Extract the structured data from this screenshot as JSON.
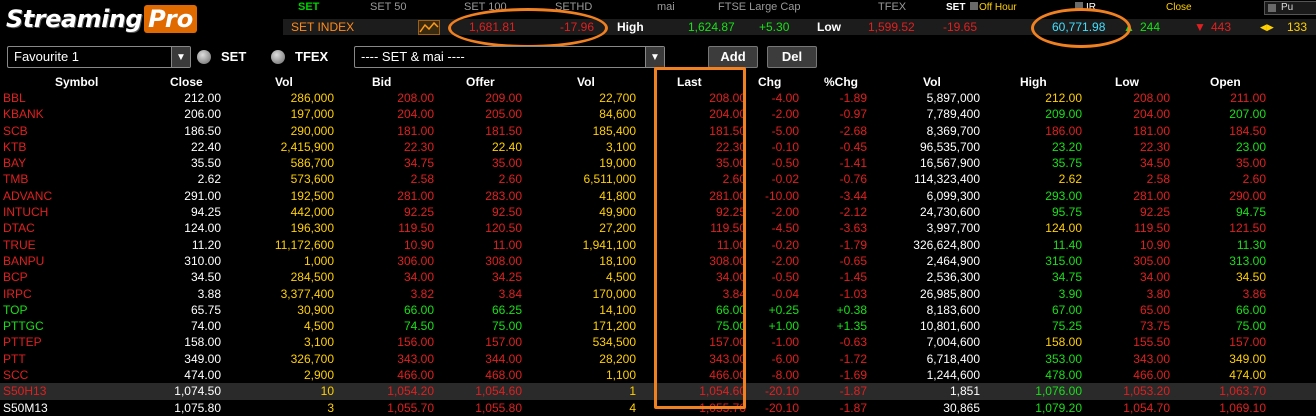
{
  "app": {
    "brand_main": "Streaming",
    "brand_sub": "Pro"
  },
  "market_tabs": [
    "SET",
    "SET 50",
    "SET 100",
    "SETHD",
    "mai",
    "FTSE Large Cap",
    "TFEX"
  ],
  "market_status": {
    "market": "SET",
    "state": "Off Hour",
    "ir": "IR",
    "session": "Close",
    "push": "Pu"
  },
  "index_bar": {
    "name": "SET INDEX",
    "value": "1,681.81",
    "change": "-17.96",
    "high_label": "High",
    "high_value": "1,624.87",
    "high_change": "+5.30",
    "low_label": "Low",
    "low_value": "1,599.52",
    "low_change": "-19.65",
    "volume": "60,771.98",
    "up_count": "244",
    "down_count": "443",
    "unchanged_count": "133"
  },
  "toolbar": {
    "favourite": "Favourite 1",
    "radio_set": "SET",
    "radio_tfex": "TFEX",
    "market_select": "---- SET & mai ----",
    "add_label": "Add",
    "del_label": "Del"
  },
  "table": {
    "headers": [
      "Symbol",
      "Close",
      "Vol",
      "Bid",
      "Offer",
      "Vol",
      "Last",
      "Chg",
      "%Chg",
      "Vol",
      "High",
      "Low",
      "Open"
    ],
    "rows": [
      {
        "symbol": "BBL",
        "close": "212.00",
        "bidvol": "286,000",
        "bid": "208.00",
        "offer": "209.00",
        "offervol": "22,700",
        "last": "208.00",
        "chg": "-4.00",
        "pchg": "-1.89",
        "vol": "5,897,000",
        "high": "212.00",
        "low": "208.00",
        "open": "211.00",
        "c": {
          "sym": "red",
          "bid": "red",
          "offer": "red",
          "last": "red",
          "chg": "red",
          "pchg": "red",
          "high": "yel",
          "low": "red",
          "open": "red"
        }
      },
      {
        "symbol": "KBANK",
        "close": "206.00",
        "bidvol": "197,000",
        "bid": "204.00",
        "offer": "205.00",
        "offervol": "84,600",
        "last": "204.00",
        "chg": "-2.00",
        "pchg": "-0.97",
        "vol": "7,789,400",
        "high": "209.00",
        "low": "204.00",
        "open": "207.00",
        "c": {
          "sym": "red",
          "bid": "red",
          "offer": "red",
          "last": "red",
          "chg": "red",
          "pchg": "red",
          "high": "grn",
          "low": "red",
          "open": "grn"
        }
      },
      {
        "symbol": "SCB",
        "close": "186.50",
        "bidvol": "290,000",
        "bid": "181.00",
        "offer": "181.50",
        "offervol": "185,400",
        "last": "181.50",
        "chg": "-5.00",
        "pchg": "-2.68",
        "vol": "8,369,700",
        "high": "186.00",
        "low": "181.00",
        "open": "184.50",
        "c": {
          "sym": "red",
          "bid": "red",
          "offer": "red",
          "last": "red",
          "chg": "red",
          "pchg": "red",
          "high": "red",
          "low": "red",
          "open": "red"
        }
      },
      {
        "symbol": "KTB",
        "close": "22.40",
        "bidvol": "2,415,900",
        "bid": "22.30",
        "offer": "22.40",
        "offervol": "3,100",
        "last": "22.30",
        "chg": "-0.10",
        "pchg": "-0.45",
        "vol": "96,535,700",
        "high": "23.20",
        "low": "22.30",
        "open": "23.00",
        "c": {
          "sym": "red",
          "bid": "red",
          "offer": "yel",
          "last": "red",
          "chg": "red",
          "pchg": "red",
          "high": "grn",
          "low": "red",
          "open": "grn"
        }
      },
      {
        "symbol": "BAY",
        "close": "35.50",
        "bidvol": "586,700",
        "bid": "34.75",
        "offer": "35.00",
        "offervol": "19,000",
        "last": "35.00",
        "chg": "-0.50",
        "pchg": "-1.41",
        "vol": "16,567,900",
        "high": "35.75",
        "low": "34.50",
        "open": "35.00",
        "c": {
          "sym": "red",
          "bid": "red",
          "offer": "red",
          "last": "red",
          "chg": "red",
          "pchg": "red",
          "high": "grn",
          "low": "red",
          "open": "red"
        }
      },
      {
        "symbol": "TMB",
        "close": "2.62",
        "bidvol": "573,600",
        "bid": "2.58",
        "offer": "2.60",
        "offervol": "6,511,000",
        "last": "2.60",
        "chg": "-0.02",
        "pchg": "-0.76",
        "vol": "114,323,400",
        "high": "2.62",
        "low": "2.58",
        "open": "2.60",
        "c": {
          "sym": "red",
          "bid": "red",
          "offer": "red",
          "last": "red",
          "chg": "red",
          "pchg": "red",
          "high": "yel",
          "low": "red",
          "open": "red"
        }
      },
      {
        "symbol": "ADVANC",
        "close": "291.00",
        "bidvol": "192,500",
        "bid": "281.00",
        "offer": "283.00",
        "offervol": "41,800",
        "last": "281.00",
        "chg": "-10.00",
        "pchg": "-3.44",
        "vol": "6,099,300",
        "high": "293.00",
        "low": "281.00",
        "open": "290.00",
        "c": {
          "sym": "red",
          "bid": "red",
          "offer": "red",
          "last": "red",
          "chg": "red",
          "pchg": "red",
          "high": "grn",
          "low": "red",
          "open": "red"
        }
      },
      {
        "symbol": "INTUCH",
        "close": "94.25",
        "bidvol": "442,000",
        "bid": "92.25",
        "offer": "92.50",
        "offervol": "49,900",
        "last": "92.25",
        "chg": "-2.00",
        "pchg": "-2.12",
        "vol": "24,730,600",
        "high": "95.75",
        "low": "92.25",
        "open": "94.75",
        "c": {
          "sym": "red",
          "bid": "red",
          "offer": "red",
          "last": "red",
          "chg": "red",
          "pchg": "red",
          "high": "grn",
          "low": "red",
          "open": "grn"
        }
      },
      {
        "symbol": "DTAC",
        "close": "124.00",
        "bidvol": "196,300",
        "bid": "119.50",
        "offer": "120.50",
        "offervol": "27,200",
        "last": "119.50",
        "chg": "-4.50",
        "pchg": "-3.63",
        "vol": "3,997,700",
        "high": "124.00",
        "low": "119.50",
        "open": "121.50",
        "c": {
          "sym": "red",
          "bid": "red",
          "offer": "red",
          "last": "red",
          "chg": "red",
          "pchg": "red",
          "high": "yel",
          "low": "red",
          "open": "red"
        }
      },
      {
        "symbol": "TRUE",
        "close": "11.20",
        "bidvol": "11,172,600",
        "bid": "10.90",
        "offer": "11.00",
        "offervol": "1,941,100",
        "last": "11.00",
        "chg": "-0.20",
        "pchg": "-1.79",
        "vol": "326,624,800",
        "high": "11.40",
        "low": "10.90",
        "open": "11.30",
        "c": {
          "sym": "red",
          "bid": "red",
          "offer": "red",
          "last": "red",
          "chg": "red",
          "pchg": "red",
          "high": "grn",
          "low": "red",
          "open": "grn"
        }
      },
      {
        "symbol": "BANPU",
        "close": "310.00",
        "bidvol": "1,000",
        "bid": "306.00",
        "offer": "308.00",
        "offervol": "18,100",
        "last": "308.00",
        "chg": "-2.00",
        "pchg": "-0.65",
        "vol": "2,464,900",
        "high": "315.00",
        "low": "305.00",
        "open": "313.00",
        "c": {
          "sym": "red",
          "bid": "red",
          "offer": "red",
          "last": "red",
          "chg": "red",
          "pchg": "red",
          "high": "grn",
          "low": "red",
          "open": "grn"
        }
      },
      {
        "symbol": "BCP",
        "close": "34.50",
        "bidvol": "284,500",
        "bid": "34.00",
        "offer": "34.25",
        "offervol": "4,500",
        "last": "34.00",
        "chg": "-0.50",
        "pchg": "-1.45",
        "vol": "2,536,300",
        "high": "34.75",
        "low": "34.00",
        "open": "34.50",
        "c": {
          "sym": "red",
          "bid": "red",
          "offer": "red",
          "last": "red",
          "chg": "red",
          "pchg": "red",
          "high": "grn",
          "low": "red",
          "open": "yel"
        }
      },
      {
        "symbol": "IRPC",
        "close": "3.88",
        "bidvol": "3,377,400",
        "bid": "3.82",
        "offer": "3.84",
        "offervol": "170,000",
        "last": "3.84",
        "chg": "-0.04",
        "pchg": "-1.03",
        "vol": "26,985,800",
        "high": "3.90",
        "low": "3.80",
        "open": "3.86",
        "c": {
          "sym": "red",
          "bid": "red",
          "offer": "red",
          "last": "red",
          "chg": "red",
          "pchg": "red",
          "high": "grn",
          "low": "red",
          "open": "red"
        }
      },
      {
        "symbol": "TOP",
        "close": "65.75",
        "bidvol": "30,900",
        "bid": "66.00",
        "offer": "66.25",
        "offervol": "14,100",
        "last": "66.00",
        "chg": "+0.25",
        "pchg": "+0.38",
        "vol": "8,183,600",
        "high": "67.00",
        "low": "65.00",
        "open": "66.00",
        "c": {
          "sym": "grn",
          "bid": "grn",
          "offer": "grn",
          "last": "grn",
          "chg": "grn",
          "pchg": "grn",
          "high": "grn",
          "low": "red",
          "open": "grn"
        }
      },
      {
        "symbol": "PTTGC",
        "close": "74.00",
        "bidvol": "4,500",
        "bid": "74.50",
        "offer": "75.00",
        "offervol": "171,200",
        "last": "75.00",
        "chg": "+1.00",
        "pchg": "+1.35",
        "vol": "10,801,600",
        "high": "75.25",
        "low": "73.75",
        "open": "75.00",
        "c": {
          "sym": "grn",
          "bid": "grn",
          "offer": "grn",
          "last": "grn",
          "chg": "grn",
          "pchg": "grn",
          "high": "grn",
          "low": "red",
          "open": "grn"
        }
      },
      {
        "symbol": "PTTEP",
        "close": "158.00",
        "bidvol": "3,100",
        "bid": "156.00",
        "offer": "157.00",
        "offervol": "534,500",
        "last": "157.00",
        "chg": "-1.00",
        "pchg": "-0.63",
        "vol": "7,004,600",
        "high": "158.00",
        "low": "155.50",
        "open": "157.00",
        "c": {
          "sym": "red",
          "bid": "red",
          "offer": "red",
          "last": "red",
          "chg": "red",
          "pchg": "red",
          "high": "yel",
          "low": "red",
          "open": "red"
        }
      },
      {
        "symbol": "PTT",
        "close": "349.00",
        "bidvol": "326,700",
        "bid": "343.00",
        "offer": "344.00",
        "offervol": "28,200",
        "last": "343.00",
        "chg": "-6.00",
        "pchg": "-1.72",
        "vol": "6,718,400",
        "high": "353.00",
        "low": "343.00",
        "open": "349.00",
        "c": {
          "sym": "red",
          "bid": "red",
          "offer": "red",
          "last": "red",
          "chg": "red",
          "pchg": "red",
          "high": "grn",
          "low": "red",
          "open": "yel"
        }
      },
      {
        "symbol": "SCC",
        "close": "474.00",
        "bidvol": "2,900",
        "bid": "466.00",
        "offer": "468.00",
        "offervol": "1,100",
        "last": "466.00",
        "chg": "-8.00",
        "pchg": "-1.69",
        "vol": "1,244,600",
        "high": "478.00",
        "low": "466.00",
        "open": "474.00",
        "c": {
          "sym": "red",
          "bid": "red",
          "offer": "red",
          "last": "red",
          "chg": "red",
          "pchg": "red",
          "high": "grn",
          "low": "red",
          "open": "yel"
        }
      },
      {
        "symbol": "S50H13",
        "close": "1,074.50",
        "bidvol": "10",
        "bid": "1,054.20",
        "offer": "1,054.60",
        "offervol": "1",
        "last": "1,054.60",
        "chg": "-20.10",
        "pchg": "-1.87",
        "vol": "1,851",
        "high": "1,076.00",
        "low": "1,053.20",
        "open": "1,063.70",
        "hl": true,
        "c": {
          "sym": "red",
          "bid": "red",
          "offer": "red",
          "last": "red",
          "chg": "red",
          "pchg": "red",
          "high": "grn",
          "low": "red",
          "open": "red",
          "bidvol": "yel",
          "offervol": "yel"
        }
      },
      {
        "symbol": "S50M13",
        "close": "1,075.80",
        "bidvol": "3",
        "bid": "1,055.70",
        "offer": "1,055.80",
        "offervol": "4",
        "last": "1,055.70",
        "chg": "-20.10",
        "pchg": "-1.87",
        "vol": "30,865",
        "high": "1,079.20",
        "low": "1,054.70",
        "open": "1,069.10",
        "c": {
          "sym": "wht",
          "bid": "red",
          "offer": "red",
          "last": "red",
          "chg": "red",
          "pchg": "red",
          "high": "grn",
          "low": "red",
          "open": "red",
          "bidvol": "yel",
          "offervol": "yel"
        }
      }
    ]
  },
  "colors": {
    "accent_orange": "#f08020",
    "up": "#18e018",
    "down": "#e02020",
    "unchanged": "#ffd000",
    "volume": "#40e0ff"
  }
}
